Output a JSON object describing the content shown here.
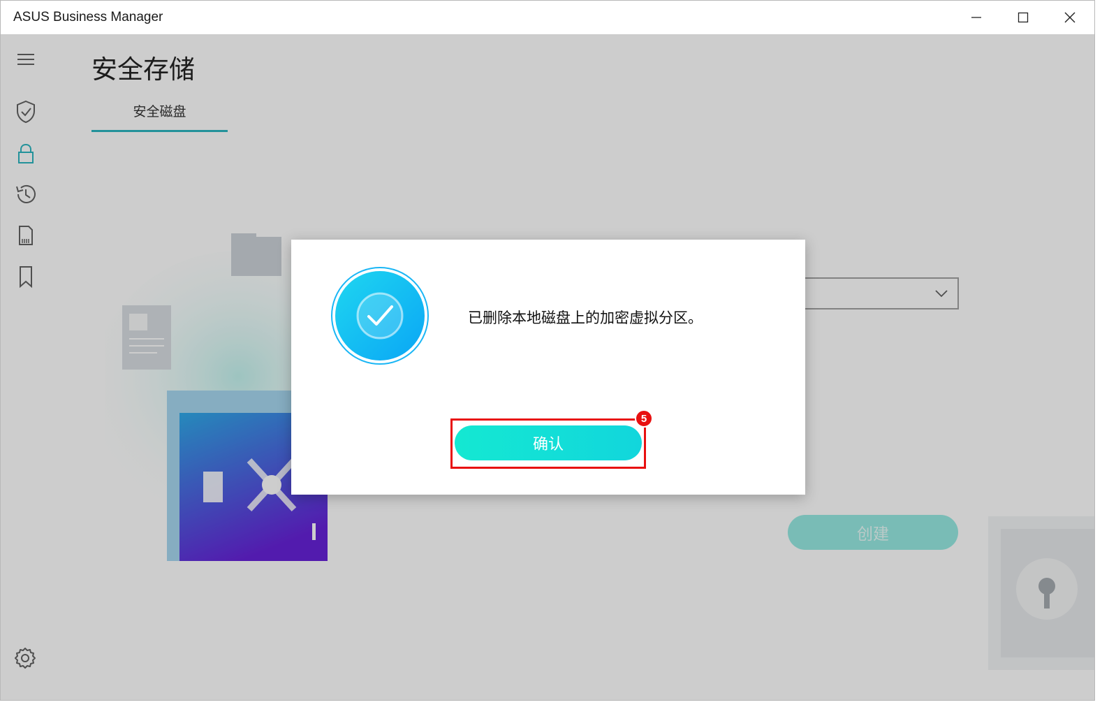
{
  "window": {
    "title": "ASUS Business Manager"
  },
  "page": {
    "title": "安全存储",
    "tabs": [
      {
        "label": "安全磁盘",
        "active": true
      }
    ]
  },
  "sidebar": {
    "items": [
      {
        "icon": "menu-icon"
      },
      {
        "icon": "shield-check-icon"
      },
      {
        "icon": "lock-icon",
        "active": true
      },
      {
        "icon": "history-icon"
      },
      {
        "icon": "sd-card-icon"
      },
      {
        "icon": "bookmark-icon"
      }
    ],
    "footer_icon": "gear-icon"
  },
  "background": {
    "create_label": "创建"
  },
  "dialog": {
    "message": "已删除本地磁盘上的加密虚拟分区。",
    "confirm_label": "确认",
    "step_number": "5"
  },
  "colors": {
    "accent": "#1ab0ba",
    "confirm_start": "#14e8d2",
    "confirm_end": "#12d6dc",
    "highlight": "#e81010",
    "success_blue": "#1ab6f5"
  }
}
